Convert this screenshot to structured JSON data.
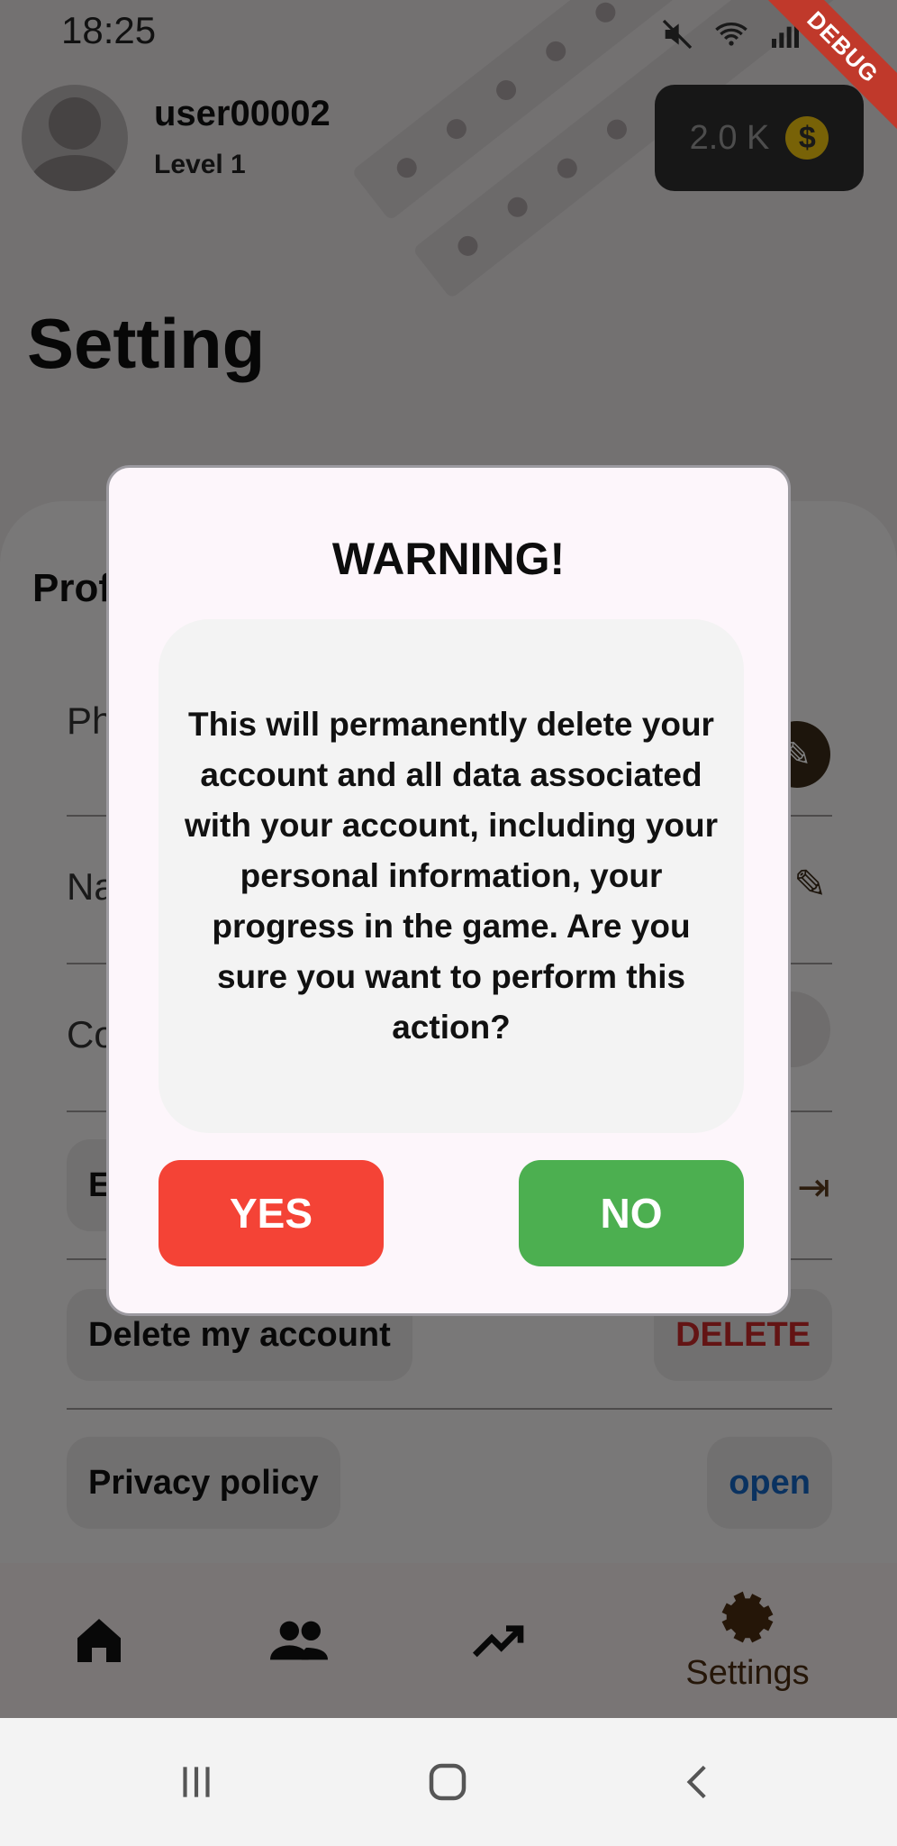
{
  "status_bar": {
    "time": "18:25"
  },
  "debug_banner": "DEBUG",
  "header": {
    "username": "user00002",
    "level": "Level 1",
    "coins": "2.0 K",
    "coin_symbol": "$"
  },
  "page": {
    "title": "Setting"
  },
  "settings": {
    "section_title_partial": "Prof",
    "rows_partial": [
      "Ph",
      "Na",
      "Co",
      "E"
    ],
    "delete_account": {
      "label": "Delete my account",
      "action": "DELETE"
    },
    "privacy_policy": {
      "label": "Privacy policy",
      "action": "open"
    }
  },
  "bottom_nav": {
    "settings_label": "Settings"
  },
  "dialog": {
    "title": "WARNING!",
    "message": "This will permanently delete your account and all data associated with your account, including your personal information, your progress in the game. Are you sure you want to perform this action?",
    "yes_label": "YES",
    "no_label": "NO"
  },
  "colors": {
    "yes": "#f44336",
    "no": "#4caf50",
    "delete": "#c62828",
    "open": "#1565c0",
    "nav_active": "#4a2c10"
  }
}
